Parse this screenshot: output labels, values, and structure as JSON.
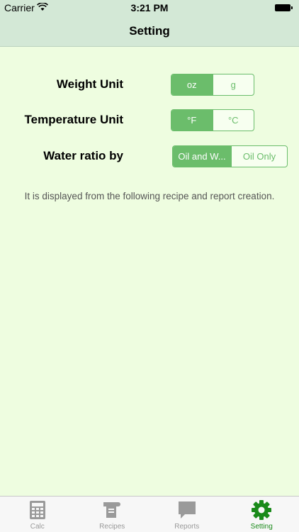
{
  "status_bar": {
    "carrier": "Carrier",
    "time": "3:21 PM"
  },
  "nav": {
    "title": "Setting"
  },
  "settings": {
    "weight": {
      "label": "Weight Unit",
      "options": [
        "oz",
        "g"
      ],
      "selected": "oz"
    },
    "temperature": {
      "label": "Temperature Unit",
      "options": [
        "°F",
        "°C"
      ],
      "selected": "°F"
    },
    "water": {
      "label": "Water ratio by",
      "options": [
        "Oil and W...",
        "Oil Only"
      ],
      "selected": "Oil and W..."
    }
  },
  "note": "It is displayed from the following recipe and report creation.",
  "tabs": [
    {
      "label": "Calc",
      "icon": "calculator-icon"
    },
    {
      "label": "Recipes",
      "icon": "recipes-icon"
    },
    {
      "label": "Reports",
      "icon": "speech-bubble-icon"
    },
    {
      "label": "Setting",
      "icon": "gear-icon"
    }
  ],
  "colors": {
    "accent": "#6bbd6b",
    "tab_selected": "#1a8a1a",
    "tab_inactive": "#999999",
    "background": "#eefde0",
    "nav": "#d3e8d6"
  }
}
